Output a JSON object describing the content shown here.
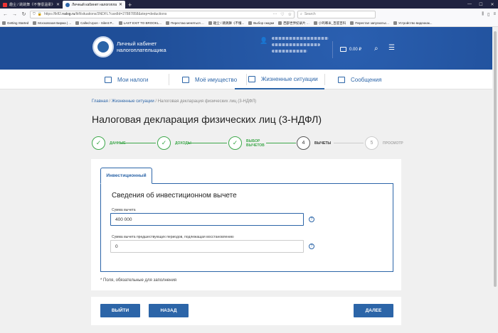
{
  "browser": {
    "tabs": [
      {
        "title": "趣尘 / 跳跳舞《不懂很温柔》",
        "active": false
      },
      {
        "title": "Личный кабинет налогоплательщика",
        "active": true
      }
    ],
    "new_tab_icon": "+",
    "url": {
      "prefix": "https://lkfl2.",
      "domain": "nalog.ru",
      "path": "/lkfl/situations/3NDFL?cardId=27887858&step=deductions"
    },
    "search_placeholder": "Search",
    "bookmarks": [
      "Getting Started",
      "Московская Биржа | ...",
      "Called Upon - Silent P...",
      "LAST EXIT TO BROOKL...",
      "Перестаю меняться ...",
      "趣尘 / 跳跳舞《不懂...",
      "Выбор скидки",
      "西部世界纪录片 ...",
      "小鸡啄米_百度百科",
      "Перестал запускатьс...",
      "Устройство видеокак..."
    ]
  },
  "header": {
    "brand_line1": "Личный кабинет",
    "brand_line2": "налогоплательщика",
    "balance": "0.00 ₽"
  },
  "nav": {
    "items": [
      {
        "label": "Мои налоги",
        "icon": "calculator-icon",
        "active": false
      },
      {
        "label": "Моё имущество",
        "icon": "property-icon",
        "active": false
      },
      {
        "label": "Жизненные ситуации",
        "icon": "list-icon",
        "active": true
      },
      {
        "label": "Сообщения",
        "icon": "envelope-icon",
        "active": false
      }
    ]
  },
  "breadcrumb": {
    "home": "Главная",
    "sep": " / ",
    "situations": "Жизненные ситуации",
    "current": "Налоговая декларация физических лиц (3-НДФЛ)"
  },
  "page_title": "Налоговая декларация физических лиц (3-НДФЛ)",
  "steps": [
    {
      "label_line1": "ДАННЫЕ",
      "label_line2": "",
      "status": "done",
      "mark": "✓"
    },
    {
      "label_line1": "ДОХОДЫ",
      "label_line2": "",
      "status": "done",
      "mark": "✓"
    },
    {
      "label_line1": "ВЫБОР",
      "label_line2": "ВЫЧЕТОВ",
      "status": "done",
      "mark": "✓"
    },
    {
      "label_line1": "ВЫЧЕТЫ",
      "label_line2": "",
      "status": "current",
      "mark": "4"
    },
    {
      "label_line1": "ПРОСМОТР",
      "label_line2": "",
      "status": "future",
      "mark": "5"
    }
  ],
  "form": {
    "tab_label": "Инвестиционный",
    "section_title": "Сведения об инвестиционном вычете",
    "field1_label": "Сумма вычета",
    "field1_value": "400 000",
    "field2_label": "Сумма вычета предшествующих периодов, подлежащая восстановлению",
    "field2_value": "0",
    "help_mark": "?",
    "required_note": "* Поля, обязательные для заполнения"
  },
  "buttons": {
    "exit": "ВЫЙТИ",
    "back": "НАЗАД",
    "next": "ДАЛЕЕ"
  }
}
